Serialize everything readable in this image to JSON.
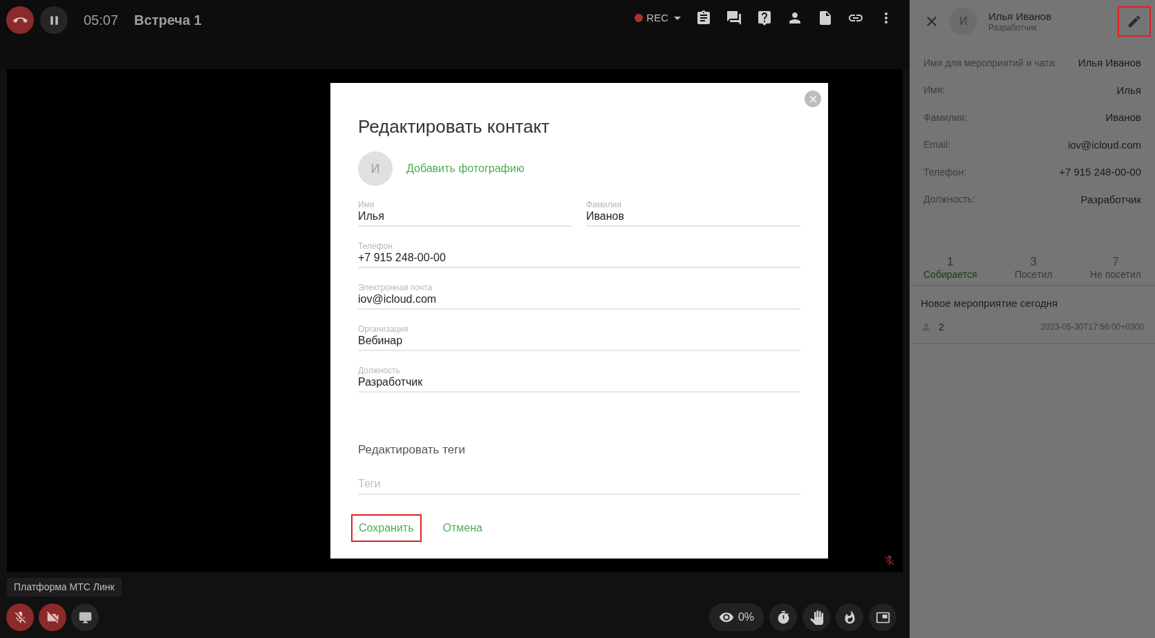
{
  "call_bar": {
    "timer": "05:07",
    "title": "Встреча 1",
    "rec_label": "REC",
    "recording": true
  },
  "video": {
    "presenter_label": "Платформа МТС Линк",
    "speaker_muted": true
  },
  "controls": {
    "mic_muted": true,
    "camera_off": true,
    "attention": "0%"
  },
  "dialog": {
    "title": "Редактировать контакт",
    "avatar_initial": "И",
    "add_photo": "Добавить фотографию",
    "field_rows": [
      [
        {
          "label": "Имя",
          "value": "Илья"
        },
        {
          "label": "Фамилия",
          "value": "Иванов"
        }
      ],
      [
        {
          "label": "Телефон",
          "value": "+7 915 248-00-00"
        }
      ],
      [
        {
          "label": "Электронная почта",
          "value": "iov@icloud.com"
        }
      ],
      [
        {
          "label": "Организация",
          "value": "Вебинар"
        }
      ],
      [
        {
          "label": "Должность",
          "value": "Разработчик"
        }
      ]
    ],
    "tags_heading": "Редактировать теги",
    "tags_field": {
      "placeholder": "Теги"
    },
    "buttons": [
      {
        "label": "Сохранить",
        "highlighted": true
      },
      {
        "label": "Отмена",
        "highlighted": false
      }
    ]
  },
  "contact_panel": {
    "avatar_initial": "И",
    "name": "Илья Иванов",
    "role": "Разработчик",
    "edit_highlighted": true,
    "details": [
      {
        "label": "Имя для мероприятий и чата:",
        "value": "Илья Иванов"
      },
      {
        "label": "Имя:",
        "value": "Илья"
      },
      {
        "label": "Фамилия:",
        "value": "Иванов"
      },
      {
        "label": "Email:",
        "value": "iov@icloud.com"
      },
      {
        "label": "Телефон:",
        "value": "+7 915 248-00-00"
      },
      {
        "label": "Должность:",
        "value": "Разработчик"
      }
    ],
    "tabs": [
      {
        "count": "1",
        "label": "Собирается",
        "selected": true
      },
      {
        "count": "3",
        "label": "Посетил",
        "selected": false
      },
      {
        "count": "7",
        "label": "Не посетил",
        "selected": false
      }
    ],
    "events": [
      {
        "title": "Новое мероприятие сегодня",
        "participants": "2",
        "datetime": "2023-05-30T17:56:00+0300"
      }
    ]
  }
}
